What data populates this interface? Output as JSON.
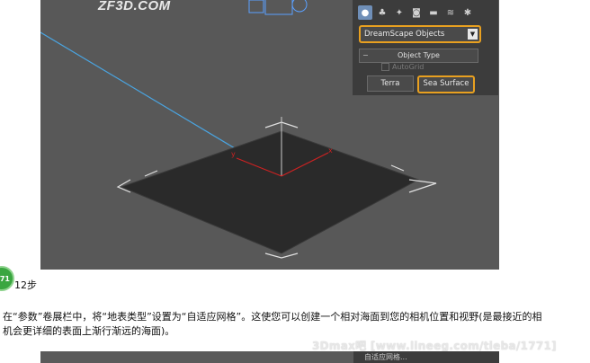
{
  "viewport": {
    "logo_text": "ZF3D.COM",
    "axis_x": "x",
    "axis_y": "y"
  },
  "panel": {
    "tab_icons": [
      "geometry-sphere-icon",
      "shapes-icon",
      "lights-icon",
      "cameras-icon",
      "helpers-icon",
      "spacewarps-icon",
      "systems-icon"
    ],
    "dropdown_value": "DreamScape Objects",
    "rollout_title": "Object Type",
    "autogrid_label": "AutoGrid",
    "button_terra": "Terra",
    "button_sea": "Sea Surface",
    "highlight_color": "#e8a020"
  },
  "article": {
    "step_badge": "71",
    "step_title": "12步",
    "paragraph": "在“参数”卷展栏中，将“地表类型”设置为“自适应网格”。这使您可以创建一个相对海面到您的相机位置和视野(是最接近的相机会更详细的表面上渐行渐远的海面)。",
    "watermark": "3Dmax吧  [www.lineeg.com/tieba/1771]"
  },
  "next_shot": {
    "label": "自适应网格..."
  }
}
